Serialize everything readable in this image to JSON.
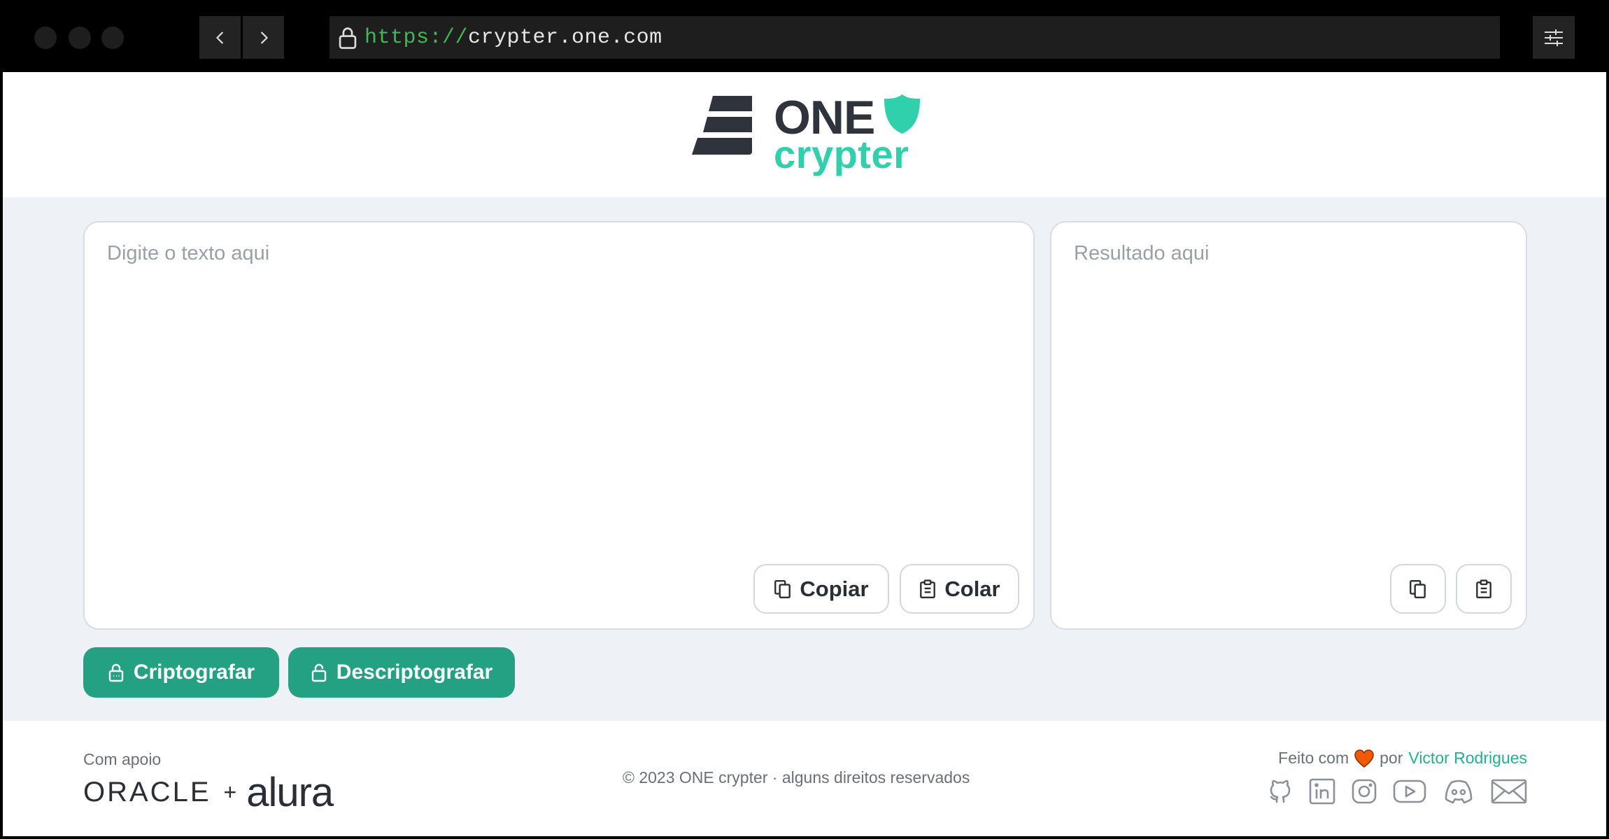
{
  "browser": {
    "url_scheme": "https://",
    "url_host": "crypter.one.com"
  },
  "logo": {
    "line1": "ONE",
    "line2": "crypter"
  },
  "input_panel": {
    "placeholder": "Digite o texto aqui",
    "copy_label": "Copiar",
    "paste_label": "Colar"
  },
  "output_panel": {
    "placeholder": "Resultado aqui"
  },
  "actions": {
    "encrypt_label": "Criptografar",
    "decrypt_label": "Descriptografar"
  },
  "footer": {
    "support_label": "Com apoio",
    "sponsor_oracle": "ORACLE",
    "sponsor_plus": "+",
    "sponsor_alura": "alura",
    "copyright": "© 2023 ONE crypter · alguns direitos reservados",
    "made_with_prefix": "Feito com",
    "made_with_by": "por",
    "author": "Victor Rodrigues",
    "social_icons": [
      "github-icon",
      "linkedin-icon",
      "instagram-icon",
      "youtube-icon",
      "discord-icon",
      "email-icon"
    ]
  },
  "colors": {
    "brand_teal": "#2fd0ab",
    "button_teal": "#24a083",
    "dark_text": "#2f343c",
    "page_bg": "#eef2f6",
    "url_scheme_green": "#3fb950",
    "heart_orange": "#f05a00"
  }
}
